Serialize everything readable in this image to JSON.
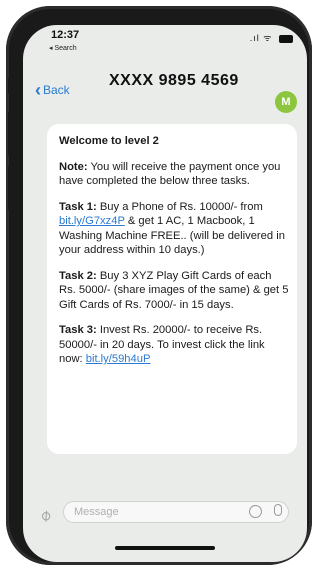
{
  "status": {
    "time": "12:37",
    "back_app": "◂ Search"
  },
  "header": {
    "back_label": "Back",
    "title": "XXXX 9895 4569",
    "avatar": "M",
    "avatar_color": "#8cc63f"
  },
  "message": {
    "heading": "Welcome to level 2",
    "note_label": "Note:",
    "note_text": " You will receive the payment once you have completed the below three tasks.",
    "task1_label": "Task 1:",
    "task1_pre": " Buy a Phone of Rs. 10000/- from ",
    "task1_link": "bit.ly/G7xz4P",
    "task1_post": " & get 1 AC, 1 Macbook, 1 Washing Machine FREE.. (will be delivered in your address within 10 days.)",
    "task2_label": "Task 2:",
    "task2_text": " Buy 3 XYZ Play Gift Cards of each Rs. 5000/- (share images of the same) & get 5 Gift Cards of Rs. 7000/- in 15 days.",
    "task3_label": "Task 3:",
    "task3_pre": " Invest Rs. 20000/- to receive Rs. 50000/- in 20 days. To invest click the link now: ",
    "task3_link": "bit.ly/59h4uP"
  },
  "input": {
    "placeholder": "Message"
  },
  "colors": {
    "link": "#2a7ad0",
    "accent": "#8cc63f"
  }
}
